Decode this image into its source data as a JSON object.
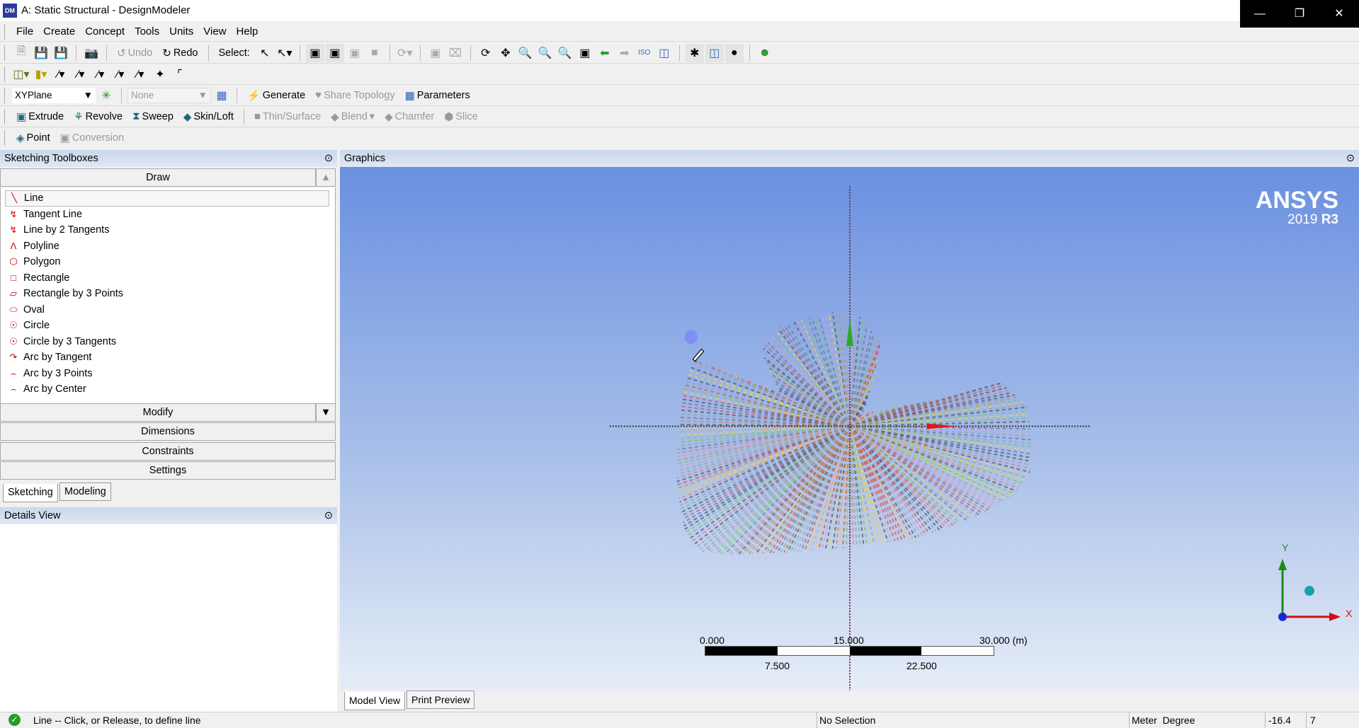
{
  "window": {
    "title": "A: Static Structural - DesignModeler",
    "app_icon": "DM",
    "controls": [
      "minimize",
      "restore",
      "close"
    ]
  },
  "menu": [
    "File",
    "Create",
    "Concept",
    "Tools",
    "Units",
    "View",
    "Help"
  ],
  "toolbar1": {
    "undo": "Undo",
    "redo": "Redo",
    "select_label": "Select:"
  },
  "toolbar3": {
    "plane": "XYPlane",
    "sketch": "None",
    "generate": "Generate",
    "share_topology": "Share Topology",
    "parameters": "Parameters"
  },
  "toolbar4": {
    "extrude": "Extrude",
    "revolve": "Revolve",
    "sweep": "Sweep",
    "skin_loft": "Skin/Loft",
    "thin_surface": "Thin/Surface",
    "blend": "Blend",
    "chamfer": "Chamfer",
    "slice": "Slice"
  },
  "toolbar5": {
    "point": "Point",
    "conversion": "Conversion"
  },
  "left": {
    "header": "Sketching Toolboxes",
    "draw": "Draw",
    "items": [
      "Line",
      "Tangent Line",
      "Line by 2 Tangents",
      "Polyline",
      "Polygon",
      "Rectangle",
      "Rectangle by 3 Points",
      "Oval",
      "Circle",
      "Circle by 3 Tangents",
      "Arc by Tangent",
      "Arc by 3 Points",
      "Arc by Center"
    ],
    "modify": "Modify",
    "dimensions": "Dimensions",
    "constraints": "Constraints",
    "settings": "Settings",
    "tabs": [
      "Sketching",
      "Modeling"
    ],
    "details": "Details View"
  },
  "graphics": {
    "header": "Graphics",
    "logo_brand": "ANSYS",
    "logo_version": "2019",
    "logo_release": "R3",
    "scale": {
      "top": [
        "0.000",
        "15.000",
        "30.000 (m)"
      ],
      "bottom": [
        "7.500",
        "22.500"
      ]
    },
    "triad": {
      "x": "X",
      "y": "Y"
    },
    "colors": {
      "bg_top": "#6a90e0",
      "bg_bottom": "#e6edf7"
    }
  },
  "view_tabs": [
    "Model View",
    "Print Preview"
  ],
  "status": {
    "message": "Line -- Click, or Release, to define line",
    "selection": "No Selection",
    "units": "Meter  Degree",
    "coord1": "-16.4",
    "coord2": "7"
  }
}
